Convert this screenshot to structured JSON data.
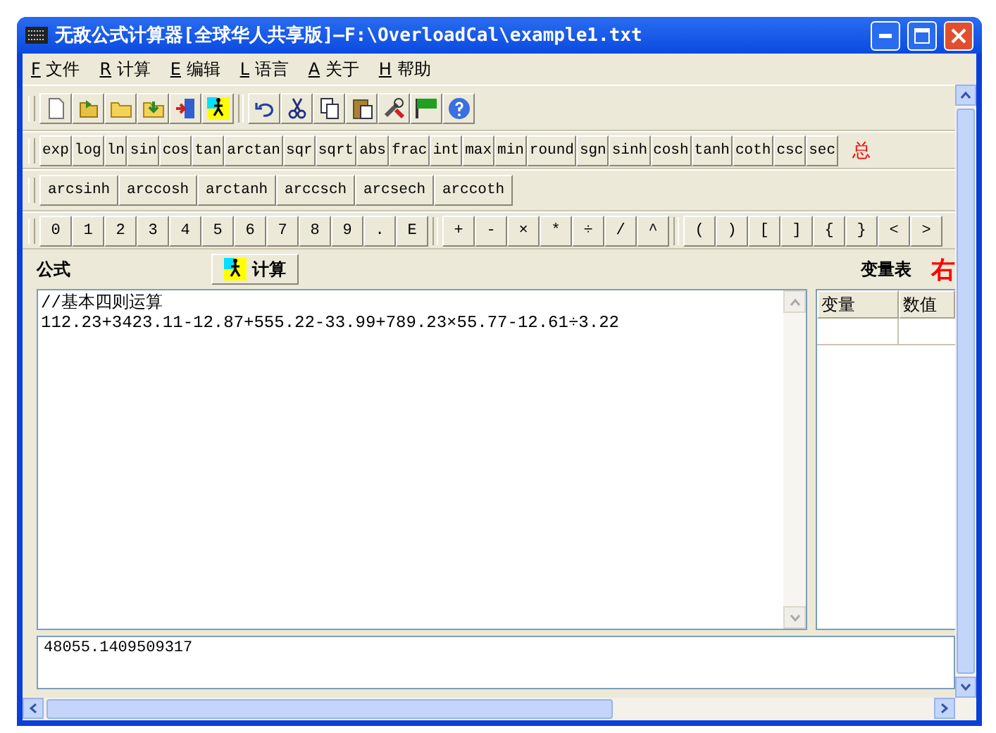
{
  "window": {
    "title": "无敌公式计算器[全球华人共享版]—F:\\OverloadCal\\example1.txt"
  },
  "menu": [
    {
      "key": "F",
      "label": "文件"
    },
    {
      "key": "R",
      "label": "计算"
    },
    {
      "key": "E",
      "label": "编辑"
    },
    {
      "key": "L",
      "label": "语言"
    },
    {
      "key": "A",
      "label": "关于"
    },
    {
      "key": "H",
      "label": "帮助"
    }
  ],
  "function_buttons": [
    "exp",
    "log",
    "ln",
    "sin",
    "cos",
    "tan",
    "arctan",
    "sqr",
    "sqrt",
    "abs",
    "frac",
    "int",
    "max",
    "min",
    "round",
    "sgn",
    "sinh",
    "cosh",
    "tanh",
    "coth",
    "csc",
    "sec"
  ],
  "function_note": "总",
  "inverse_buttons": [
    "arcsinh",
    "arccosh",
    "arctanh",
    "arccsch",
    "arcsech",
    "arccoth"
  ],
  "symbol_groups": [
    [
      "0",
      "1",
      "2",
      "3",
      "4",
      "5",
      "6",
      "7",
      "8",
      "9",
      ".",
      "E"
    ],
    [
      "+",
      "-",
      "×",
      "*",
      "÷",
      "/",
      "^"
    ],
    [
      "(",
      ")",
      "[",
      "]",
      "{",
      "}",
      "<",
      ">"
    ]
  ],
  "formula_label": "公式",
  "calc_button": "计算",
  "variables_label": "变量表",
  "side_note": "右",
  "editor_lines": [
    "//基本四则运算",
    "112.23+3423.11-12.87+555.22-33.99+789.23×55.77-12.61÷3.22"
  ],
  "variable_table": {
    "columns": [
      "变量",
      "数值"
    ]
  },
  "result": "48055.1409509317"
}
